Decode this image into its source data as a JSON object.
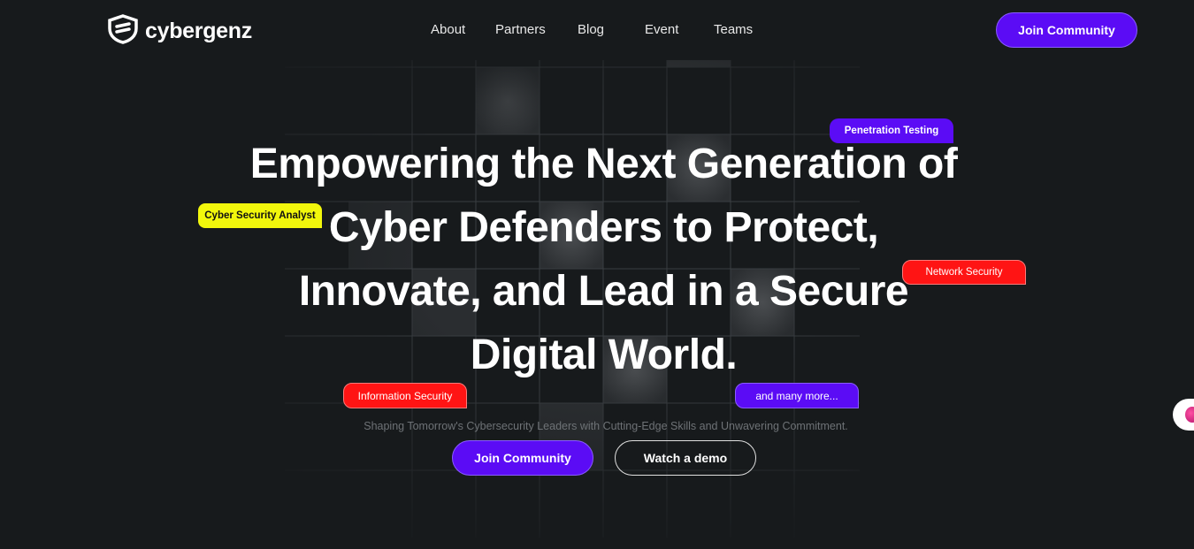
{
  "brand": {
    "name": "cybergenz"
  },
  "nav": {
    "items": [
      {
        "label": "About"
      },
      {
        "label": "Partners"
      },
      {
        "label": "Blog"
      },
      {
        "label": "Event"
      },
      {
        "label": "Teams"
      }
    ],
    "cta_label": "Join Community"
  },
  "hero": {
    "headline_line1": "Empowering the Next Generation of",
    "headline_line2": "Cyber Defenders to Protect,",
    "headline_line3": "Innovate, and Lead in a Secure",
    "headline_line4": "Digital World.",
    "subline": "Shaping Tomorrow's Cybersecurity Leaders with Cutting-Edge Skills and Unwavering Commitment.",
    "primary_button": "Join Community",
    "secondary_button": "Watch a demo"
  },
  "tags": {
    "penetration_testing": "Penetration Testing",
    "cyber_security_analyst": "Cyber Security Analyst",
    "network_security": "Network Security",
    "information_security": "Information Security",
    "many_more": "and many more..."
  },
  "colors": {
    "background": "#171a1c",
    "accent_purple": "#5b0cf5",
    "tag_red": "#ff1414",
    "tag_yellow": "#f2f70c"
  },
  "icons": {
    "logo": "shield-logo-icon",
    "side_widget": "chat-widget-icon"
  }
}
